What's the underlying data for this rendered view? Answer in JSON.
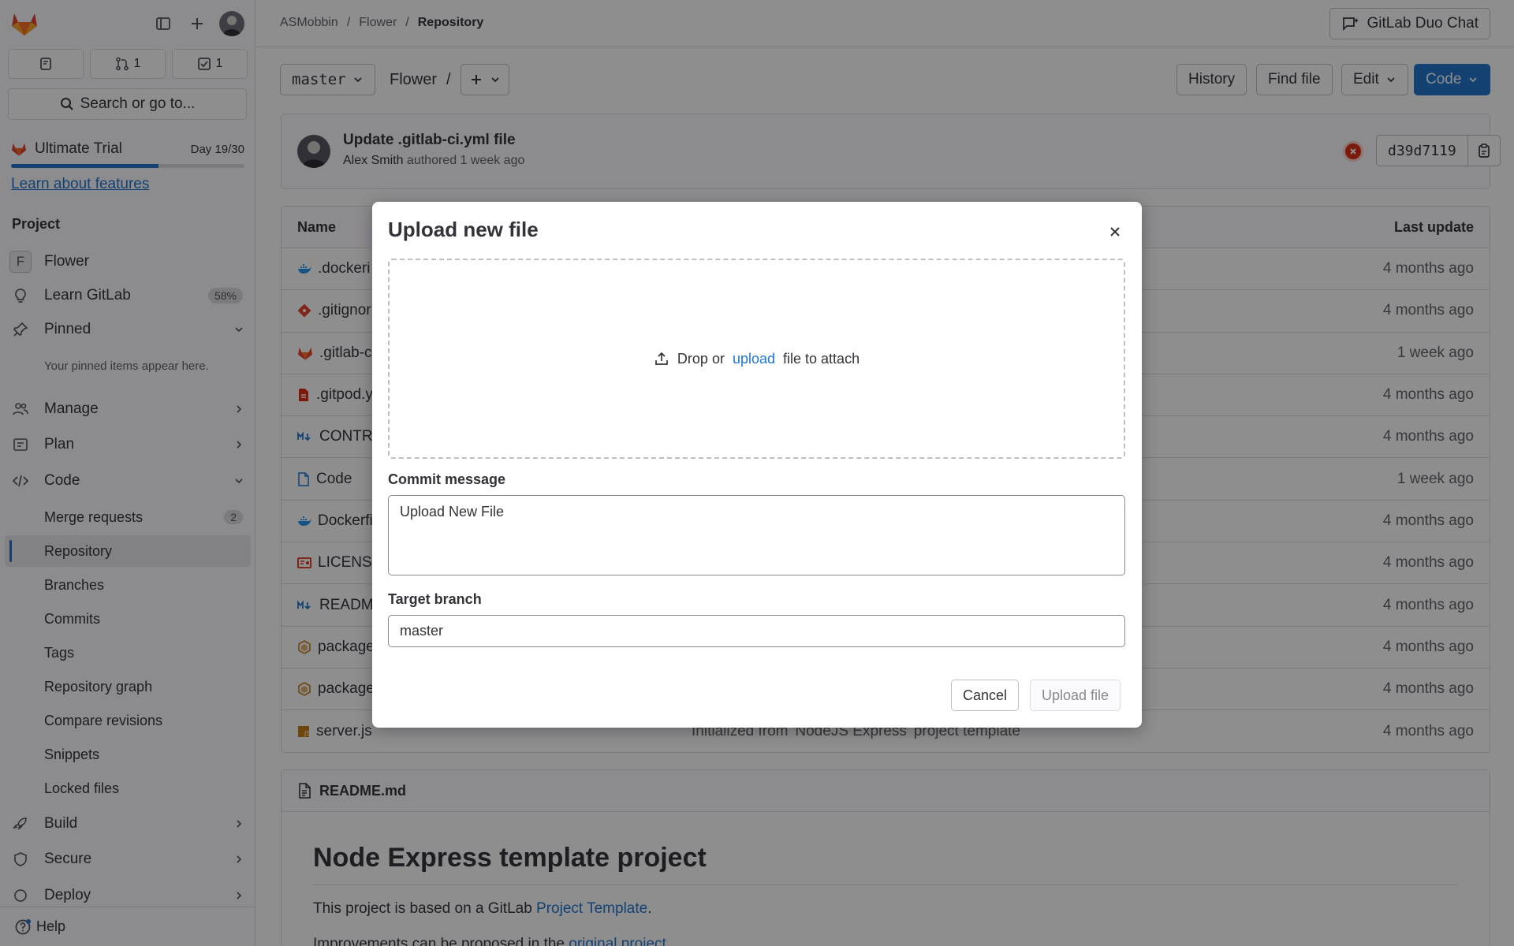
{
  "sidebar": {
    "counts": {
      "merge_requests": "1",
      "todos": "1"
    },
    "search_label": "Search or go to...",
    "trial": {
      "name": "Ultimate Trial",
      "day": "Day 19/30",
      "progress": 0.633,
      "learn_link": "Learn about features"
    },
    "section_title": "Project",
    "project": {
      "letter": "F",
      "name": "Flower"
    },
    "learn_gitlab": {
      "label": "Learn GitLab",
      "badge": "58%"
    },
    "pinned": {
      "label": "Pinned",
      "note": "Your pinned items appear here."
    },
    "items": [
      "Manage",
      "Plan",
      "Code",
      "Build",
      "Secure",
      "Deploy"
    ],
    "code_sub": [
      {
        "label": "Merge requests",
        "badge": "2"
      },
      {
        "label": "Repository"
      },
      {
        "label": "Branches"
      },
      {
        "label": "Commits"
      },
      {
        "label": "Tags"
      },
      {
        "label": "Repository graph"
      },
      {
        "label": "Compare revisions"
      },
      {
        "label": "Snippets"
      },
      {
        "label": "Locked files"
      }
    ],
    "help": "Help"
  },
  "topbar": {
    "breadcrumb": [
      "ASMobbin",
      "Flower",
      "Repository"
    ],
    "duo_chat": "GitLab Duo Chat"
  },
  "toolbar": {
    "branch": "master",
    "path_root": "Flower",
    "path_sep": "/",
    "history": "History",
    "find_file": "Find file",
    "edit": "Edit",
    "code": "Code"
  },
  "commit": {
    "title": "Update .gitlab-ci.yml file",
    "author": "Alex Smith",
    "meta": "authored 1 week ago",
    "sha": "d39d7119"
  },
  "files": {
    "headers": {
      "name": "Name",
      "last_update": "Last update"
    },
    "rows": [
      {
        "name": ".dockeri",
        "message": "",
        "updated": "4 months ago",
        "icon": "docker-icon"
      },
      {
        "name": ".gitignor",
        "message": "",
        "updated": "4 months ago",
        "icon": "git-icon"
      },
      {
        "name": ".gitlab-c",
        "message": "",
        "updated": "1 week ago",
        "icon": "gitlab-icon"
      },
      {
        "name": ".gitpod.y",
        "message": "",
        "updated": "4 months ago",
        "icon": "yaml-icon"
      },
      {
        "name": "CONTRI",
        "message": "",
        "updated": "4 months ago",
        "icon": "markdown-icon"
      },
      {
        "name": "Code",
        "message": "",
        "updated": "1 week ago",
        "icon": "file-icon"
      },
      {
        "name": "Dockerfi",
        "message": "",
        "updated": "4 months ago",
        "icon": "docker-icon"
      },
      {
        "name": "LICENSE",
        "message": "",
        "updated": "4 months ago",
        "icon": "license-icon"
      },
      {
        "name": "README",
        "message": "",
        "updated": "4 months ago",
        "icon": "markdown-icon"
      },
      {
        "name": "package",
        "message": "",
        "updated": "4 months ago",
        "icon": "npm-icon"
      },
      {
        "name": "package",
        "message": "",
        "updated": "4 months ago",
        "icon": "npm-icon"
      },
      {
        "name": "server.js",
        "message": "Initialized from 'NodeJS Express' project template",
        "updated": "4 months ago",
        "icon": "js-icon"
      }
    ]
  },
  "readme": {
    "filename": "README.md",
    "heading": "Node Express template project",
    "p1_text": "This project is based on a GitLab ",
    "p1_link": "Project Template",
    "p1_end": ".",
    "p2_text": "Improvements can be proposed in the ",
    "p2_link": "original project",
    "p2_end": "."
  },
  "modal": {
    "title": "Upload new file",
    "drop_prefix": "Drop or",
    "drop_link": "upload",
    "drop_suffix": "file to attach",
    "commit_label": "Commit message",
    "commit_value": "Upload New File",
    "branch_label": "Target branch",
    "branch_value": "master",
    "cancel": "Cancel",
    "upload": "Upload file"
  },
  "colors": {
    "accent": "#1f75cb",
    "danger": "#dd2b0e",
    "gitlab_orange": "#e24329"
  }
}
